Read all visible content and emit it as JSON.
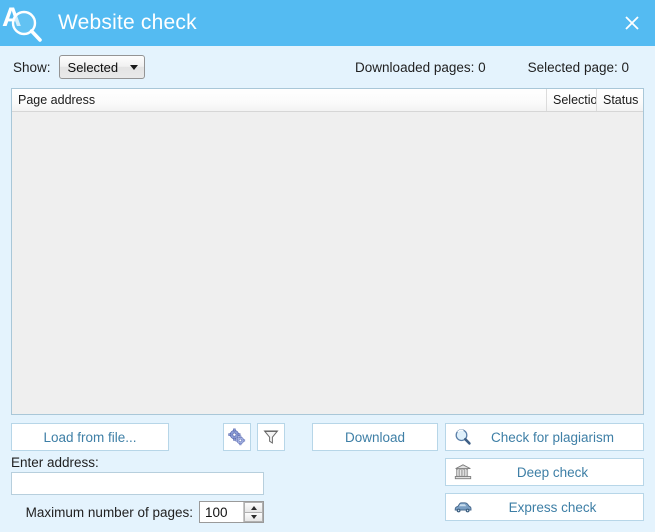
{
  "window": {
    "title": "Website check",
    "app_icon": "magnifier-a-icon",
    "close_icon": "close-icon",
    "titlebar_color": "#54bbf2",
    "body_color": "#e4f3fd",
    "accent_text_color": "#3e7fa6"
  },
  "toolbar": {
    "show_label": "Show:",
    "show_value": "Selected",
    "downloaded_pages_label": "Downloaded pages: 0",
    "selected_page_label": "Selected page: 0"
  },
  "list": {
    "columns": [
      {
        "key": "address",
        "label": "Page address"
      },
      {
        "key": "selection",
        "label": "Selectio"
      },
      {
        "key": "status",
        "label": "Status"
      }
    ],
    "rows": []
  },
  "actions": {
    "load_from_file": "Load from file...",
    "settings_icon": "gears-icon",
    "filter_icon": "funnel-filter-icon",
    "download": "Download",
    "check_for_plagiarism": "Check for plagiarism",
    "plagiarism_icon": "magnifier-icon",
    "deep_check": "Deep check",
    "deep_check_icon": "bank-building-icon",
    "express_check": "Express check",
    "express_check_icon": "car-icon"
  },
  "address": {
    "label": "Enter address:",
    "value": "",
    "placeholder": ""
  },
  "max_pages": {
    "label": "Maximum number of pages:",
    "value": "100"
  }
}
